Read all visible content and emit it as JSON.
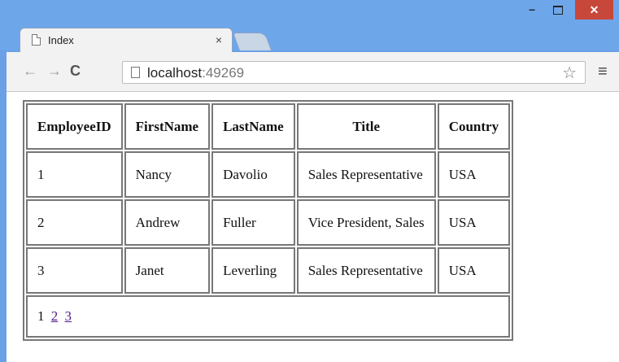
{
  "browser": {
    "tab_title": "Index",
    "tab_close": "×",
    "address_host": "localhost",
    "address_port": ":49269",
    "window_controls": {
      "minimize": "–",
      "close": "✕"
    },
    "icons": [
      "page-icon",
      "back-arrow-icon",
      "forward-arrow-icon",
      "reload-icon",
      "star-icon",
      "menu-icon"
    ],
    "colors": {
      "titlebar": "#6ea6ea",
      "close_button": "#c7483a",
      "link": "#551a8b"
    }
  },
  "table": {
    "headers": [
      "EmployeeID",
      "FirstName",
      "LastName",
      "Title",
      "Country"
    ],
    "rows": [
      [
        "1",
        "Nancy",
        "Davolio",
        "Sales Representative",
        "USA"
      ],
      [
        "2",
        "Andrew",
        "Fuller",
        "Vice President, Sales",
        "USA"
      ],
      [
        "3",
        "Janet",
        "Leverling",
        "Sales Representative",
        "USA"
      ]
    ],
    "pager": {
      "current": "1",
      "links": [
        "2",
        "3"
      ]
    }
  }
}
